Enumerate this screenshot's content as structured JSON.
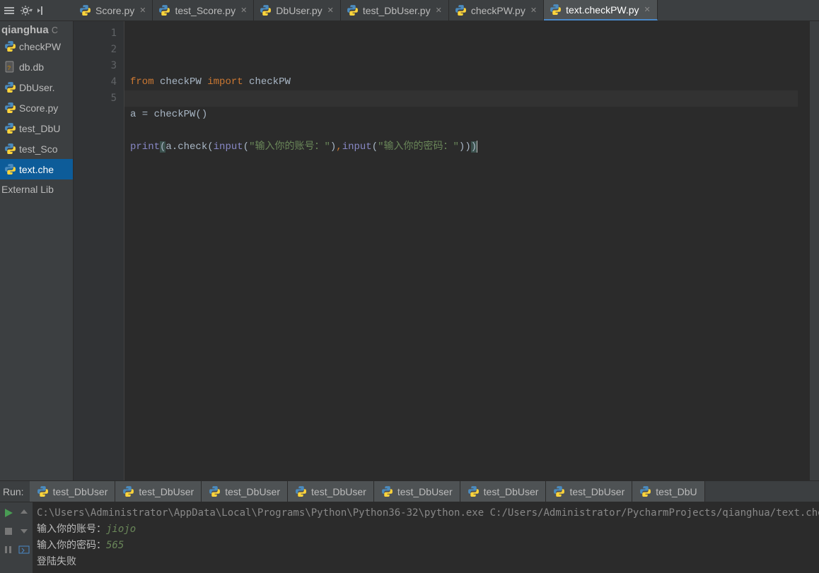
{
  "toolbar": {
    "icons": [
      "menu",
      "gear",
      "indent-left"
    ]
  },
  "nav": {
    "title": "qianghua",
    "items": [
      {
        "label": "checkPW",
        "active": false
      },
      {
        "label": "db.db",
        "active": false,
        "kind": "db"
      },
      {
        "label": "DbUser.",
        "active": false
      },
      {
        "label": "Score.py",
        "active": false
      },
      {
        "label": "test_DbU",
        "active": false
      },
      {
        "label": "test_Sco",
        "active": false
      },
      {
        "label": "text.che",
        "active": true
      }
    ],
    "ext": "External Lib"
  },
  "tabs": [
    {
      "label": "Score.py",
      "active": false
    },
    {
      "label": "test_Score.py",
      "active": false
    },
    {
      "label": "DbUser.py",
      "active": false
    },
    {
      "label": "test_DbUser.py",
      "active": false
    },
    {
      "label": "checkPW.py",
      "active": false
    },
    {
      "label": "text.checkPW.py",
      "active": true
    }
  ],
  "gutter": [
    "1",
    "2",
    "3",
    "4",
    "5"
  ],
  "code": {
    "l1a": "from",
    "l1b": " checkPW ",
    "l1c": "import",
    "l1d": " checkPW",
    "l3": "a = checkPW()",
    "l5a": "print",
    "l5b": "(",
    "l5c": "a.check(",
    "l5d": "input",
    "l5e": "(",
    "l5f": "\"输入你的账号：\"",
    "l5g": ")",
    "l5h": ",",
    "l5i": "input",
    "l5j": "(",
    "l5k": "\"输入你的密码：\"",
    "l5l": "))",
    "l5m": ")"
  },
  "run": {
    "label": "Run:",
    "tabs": [
      "test_DbUser",
      "test_DbUser",
      "test_DbUser",
      "test_DbUser",
      "test_DbUser",
      "test_DbUser",
      "test_DbUser",
      "test_DbU"
    ],
    "out_path": "C:\\Users\\Administrator\\AppData\\Local\\Programs\\Python\\Python36-32\\python.exe C:/Users/Administrator/PycharmProjects/qianghua/text.che",
    "l2a": "输入你的账号：",
    "l2b": "jiojo",
    "l3a": "输入你的密码：",
    "l3b": "565",
    "l4": "登陆失败"
  }
}
